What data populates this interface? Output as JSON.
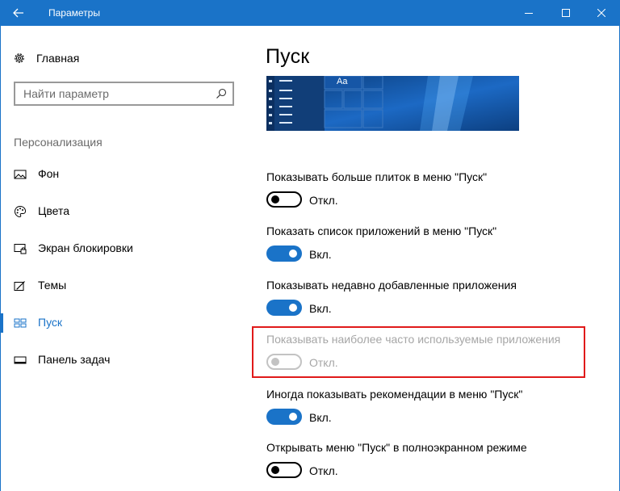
{
  "window": {
    "title": "Параметры",
    "accent": "#1a73c8",
    "back_icon": "back-arrow-icon",
    "controls": [
      "minimize-icon",
      "maximize-icon",
      "close-icon"
    ]
  },
  "sidebar": {
    "home": {
      "label": "Главная",
      "icon": "gear-icon"
    },
    "search": {
      "placeholder": "Найти параметр",
      "value": "",
      "icon": "search-icon"
    },
    "section_title": "Персонализация",
    "items": [
      {
        "label": "Фон",
        "icon": "picture-icon",
        "active": false
      },
      {
        "label": "Цвета",
        "icon": "palette-icon",
        "active": false
      },
      {
        "label": "Экран блокировки",
        "icon": "lock-screen-icon",
        "active": false
      },
      {
        "label": "Темы",
        "icon": "themes-brush-icon",
        "active": false
      },
      {
        "label": "Пуск",
        "icon": "start-tiles-icon",
        "active": true
      },
      {
        "label": "Панель задач",
        "icon": "taskbar-icon",
        "active": false
      }
    ]
  },
  "main": {
    "title": "Пуск",
    "preview": {
      "tile_text": "Aa"
    },
    "settings": [
      {
        "label": "Показывать больше плиток в меню \"Пуск\"",
        "state": "off",
        "state_label": "Откл.",
        "enabled": true
      },
      {
        "label": "Показать список приложений в меню \"Пуск\"",
        "state": "on",
        "state_label": "Вкл.",
        "enabled": true
      },
      {
        "label": "Показывать недавно добавленные приложения",
        "state": "on",
        "state_label": "Вкл.",
        "enabled": true
      },
      {
        "label": "Показывать наиболее часто используемые приложения",
        "state": "off",
        "state_label": "Откл.",
        "enabled": false
      },
      {
        "label": "Иногда показывать рекомендации в меню \"Пуск\"",
        "state": "on",
        "state_label": "Вкл.",
        "enabled": true
      },
      {
        "label": "Открывать меню \"Пуск\" в полноэкранном режиме",
        "state": "off",
        "state_label": "Откл.",
        "enabled": true
      }
    ],
    "highlight_color": "#e01a1a"
  }
}
